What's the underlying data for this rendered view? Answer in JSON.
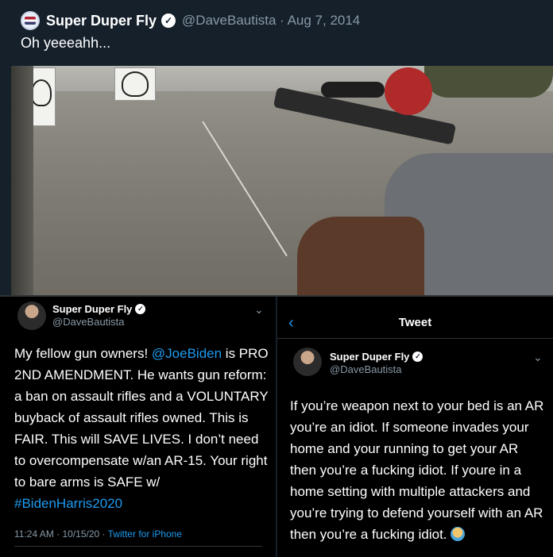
{
  "top_tweet": {
    "display_name": "Super Duper Fly",
    "handle_date": "@DaveBautista · Aug 7, 2014",
    "text": "Oh yeeeahh..."
  },
  "left_tweet": {
    "display_name": "Super Duper Fly",
    "handle": "@DaveBautista",
    "text_before_mention": "My fellow gun owners! ",
    "mention": "@JoeBiden",
    "text_middle": " is PRO 2ND AMENDMENT. He wants gun reform: a ban on assault rifles and a VOLUNTARY buyback of assault rifles owned. This is FAIR. This will SAVE LIVES. I don’t need to overcompensate w/an AR-15.  Your right to bare arms is SAFE w/ ",
    "hashtag": "#BidenHarris2020",
    "timestamp": "11:24 AM · 10/15/20 · ",
    "source": "Twitter for iPhone"
  },
  "right_tweet": {
    "header_title": "Tweet",
    "display_name": "Super Duper Fly",
    "handle": "@DaveBautista",
    "text": "If you’re weapon next to your bed is an AR you’re an idiot. If someone invades your home and your running to get your AR then you’re a fucking idiot. If youre in a home setting with multiple attackers and you’re trying to defend yourself with an AR then you’re a fucking idiot. "
  },
  "icons": {
    "verified": "verified-badge-icon",
    "back": "back-arrow-icon",
    "more": "chevron-down-icon",
    "emoji": "person-shrugging-emoji-icon"
  },
  "colors": {
    "background_dim": "#15202b",
    "background_black": "#000000",
    "link_blue": "#1d9bf0",
    "secondary_text": "#8899a6"
  }
}
